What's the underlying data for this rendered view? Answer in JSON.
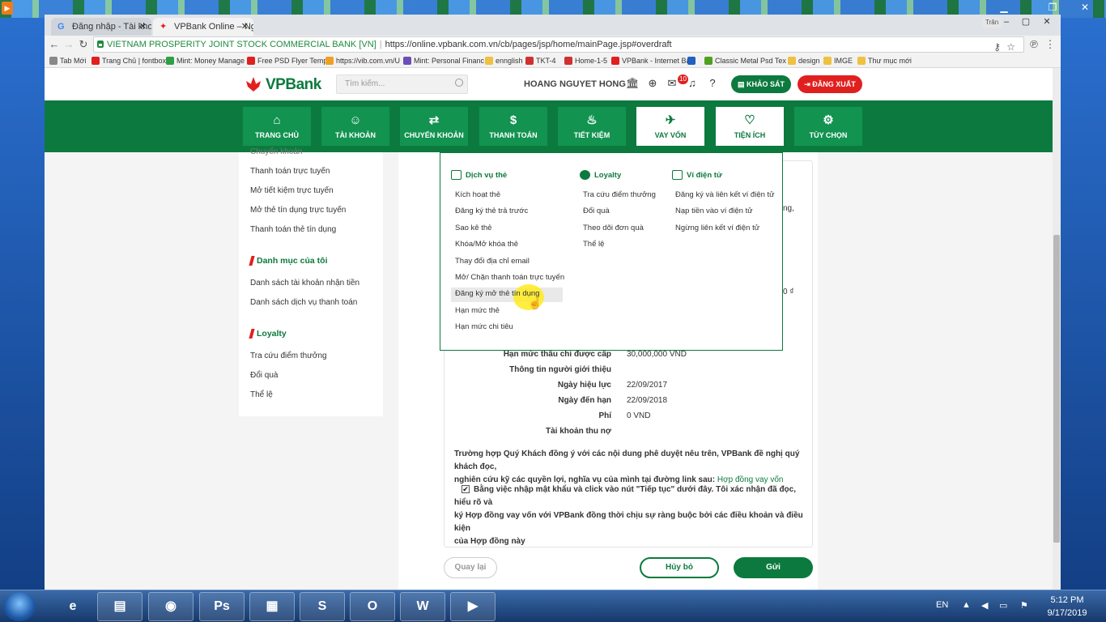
{
  "os": {
    "taskbar": {
      "language": "EN",
      "time": "5:12 PM",
      "date": "9/17/2019",
      "apps": [
        {
          "icon": "internet-explorer-icon",
          "glyph": "e"
        },
        {
          "icon": "file-explorer-icon",
          "glyph": "▤"
        },
        {
          "icon": "chrome-icon",
          "glyph": "◉"
        },
        {
          "icon": "photoshop-icon",
          "glyph": "Ps"
        },
        {
          "icon": "calculator-icon",
          "glyph": "▦"
        },
        {
          "icon": "skype-icon",
          "glyph": "S"
        },
        {
          "icon": "outlook-icon",
          "glyph": "O"
        },
        {
          "icon": "word-icon",
          "glyph": "W"
        },
        {
          "icon": "media-player-icon",
          "glyph": "▶"
        }
      ]
    }
  },
  "browser": {
    "tabs": [
      {
        "label": "Đăng nhập - Tài khoản G"
      },
      {
        "label": "VPBank Online – Ngân h"
      }
    ],
    "profile": "Trân",
    "address": {
      "cert": "VIETNAM PROSPERITY JOINT STOCK COMMERCIAL BANK [VN]",
      "url": "https://online.vpbank.com.vn/cb/pages/jsp/home/mainPage.jsp#overdraft"
    },
    "bookmarks": [
      {
        "label": "Tab Mới",
        "color": "#888888"
      },
      {
        "label": "Trang Chủ | fontbox",
        "color": "#e0201f"
      },
      {
        "label": "Mint: Money Manage",
        "color": "#2ea043"
      },
      {
        "label": "Free PSD Flyer Templ",
        "color": "#e02020"
      },
      {
        "label": "https://vib.com.vn/U",
        "color": "#f0a020"
      },
      {
        "label": "Mint: Personal Financ",
        "color": "#6a4fb5"
      },
      {
        "label": "ennglish",
        "color": "#f0c040"
      },
      {
        "label": "TKT-4",
        "color": "#d03030"
      },
      {
        "label": "Home-1-5",
        "color": "#d03030"
      },
      {
        "label": "VPBank - Internet Ba",
        "color": "#e0201f"
      },
      {
        "label": "",
        "color": "#2060c0"
      },
      {
        "label": "Classic Metal Psd Tex",
        "color": "#50a020"
      },
      {
        "label": "design",
        "color": "#f0c040"
      },
      {
        "label": "IMGE",
        "color": "#f0c040"
      },
      {
        "label": "Thư mục mới",
        "color": "#f0c040"
      }
    ]
  },
  "site": {
    "logo": "VPBank",
    "search_placeholder": "Tìm kiếm...",
    "username": "HOANG NGUYET HONG",
    "notifications": "10",
    "survey_label": "KHẢO SÁT",
    "logout_label": "ĐĂNG XUẤT",
    "nav": [
      {
        "label": "TRANG CHỦ",
        "icon": "⌂"
      },
      {
        "label": "TÀI KHOẢN",
        "icon": "☺"
      },
      {
        "label": "CHUYỂN KHOẢN",
        "icon": "⇄"
      },
      {
        "label": "THANH TOÁN",
        "icon": "$"
      },
      {
        "label": "TIẾT KIỆM",
        "icon": "♨"
      },
      {
        "label": "VAY VỐN",
        "icon": "✈"
      },
      {
        "label": "TIỆN ÍCH",
        "icon": "♡"
      },
      {
        "label": "TÙY CHỌN",
        "icon": "⚙"
      }
    ]
  },
  "sidebar": {
    "top_items": [
      "Chuyển khoản",
      "Thanh toán trực tuyến",
      "Mở tiết kiệm trực tuyến",
      "Mở thẻ tín dụng trực tuyến",
      "Thanh toán thẻ tín dụng"
    ],
    "section2_title": "Danh mục của tôi",
    "section2_items": [
      "Danh sách tài khoản nhận tiền",
      "Danh sách dịch vụ thanh toán"
    ],
    "section3_title": "Loyalty",
    "section3_items": [
      "Tra cứu điểm thưởng",
      "Đổi quà",
      "Thể lệ"
    ]
  },
  "dropdown": {
    "columns": [
      {
        "title": "Dịch vụ thẻ",
        "items": [
          "Kích hoạt thẻ",
          "Đăng ký thẻ trả trước",
          "Sao kê thẻ",
          "Khóa/Mở khóa thẻ",
          "Thay đổi địa chỉ email",
          "Mở/ Chặn thanh toán trực tuyến",
          "Đăng ký mở thẻ tín dụng",
          "Hạn mức thẻ",
          "Hạn mức chi tiêu"
        ]
      },
      {
        "title": "Loyalty",
        "items": [
          "Tra cứu điểm thưởng",
          "Đổi quà",
          "Theo dõi đơn quà",
          "Thể lệ"
        ]
      },
      {
        "title": "Ví điện tử",
        "items": [
          "Đăng ký và liên kết ví điện tử",
          "Nạp tiền vào ví điện tử",
          "Ngừng liên kết ví điện tử"
        ]
      }
    ]
  },
  "form": {
    "peek_right_1": "ng,",
    "peek_right_2": "0 ₫",
    "rows": [
      {
        "label": "Hạn mức thấu chi được cấp",
        "value": "30,000,000 VND"
      },
      {
        "label": "Thông tin người giới thiệu",
        "value": ""
      },
      {
        "label": "Ngày hiệu lực",
        "value": "22/09/2017"
      },
      {
        "label": "Ngày đến hạn",
        "value": "22/09/2018"
      },
      {
        "label": "Phí",
        "value": "0 VND"
      },
      {
        "label": "Tài khoản thu nợ",
        "value": ""
      }
    ],
    "notice_line1": "Trường hợp Quý Khách đồng ý với các nội dung phê duyệt nêu trên, VPBank đề nghị quý khách đọc,",
    "notice_line2": "nghiên cứu kỹ các quyền lợi, nghĩa vụ của mình tại đường link sau:",
    "notice_link": "Hợp đồng vay vốn",
    "agree_line1": "Bằng việc nhập mật khẩu và click vào nút \"Tiếp tục\" dưới đây. Tôi xác nhận đã đọc, hiểu rõ và",
    "agree_line2": "ký Hợp đồng vay vốn với VPBank đồng thời chịu sự ràng buộc bởi các điều khoản và điều kiện",
    "agree_line3": "của Hợp đồng này",
    "agree_checked": true,
    "back_label": "Quay lại",
    "cancel_label": "Hủy bỏ",
    "send_label": "Gửi"
  },
  "colors": {
    "brand_green": "#0c7a3e",
    "brand_red": "#e0201f"
  }
}
